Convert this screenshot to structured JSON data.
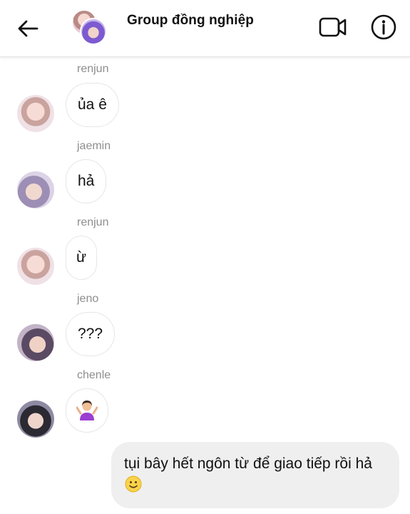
{
  "header": {
    "title": "Group đồng nghiệp",
    "back_icon": "arrow-left-icon",
    "video_icon": "video-camera-icon",
    "info_icon": "info-icon"
  },
  "messages": [
    {
      "sender": "renjun",
      "text": "ủa ê"
    },
    {
      "sender": "jaemin",
      "text": "hả"
    },
    {
      "sender": "renjun",
      "text": "ừ"
    },
    {
      "sender": "jeno",
      "text": "???"
    },
    {
      "sender": "chenle",
      "emoji": "person-shrugging-emoji"
    }
  ],
  "own_message": {
    "text": "tụi bây hết ngôn từ để giao tiếp rồi hả",
    "emoji": "slightly-smiling-face-emoji"
  },
  "colors": {
    "own_bubble": "#efefef",
    "sender_name": "#8e8e8e",
    "bubble_border": "#e6e6e6"
  }
}
